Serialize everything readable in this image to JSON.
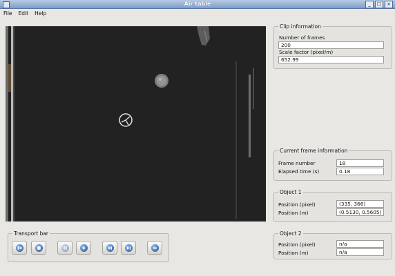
{
  "window": {
    "title": "Air table"
  },
  "menu": [
    "File",
    "Edit",
    "Help"
  ],
  "transport": {
    "title": "Transport bar",
    "buttons": [
      {
        "name": "skip-to-start-button",
        "icon": "skip-to-start-icon",
        "enabled": true
      },
      {
        "name": "step-back-button",
        "icon": "step-back-icon",
        "enabled": true
      },
      {
        "name": "pause-button",
        "icon": "pause-icon",
        "enabled": false
      },
      {
        "name": "play-button",
        "icon": "play-icon",
        "enabled": true
      },
      {
        "name": "step-forward-button",
        "icon": "step-forward-icon",
        "enabled": true
      },
      {
        "name": "skip-to-end-button",
        "icon": "skip-to-end-icon",
        "enabled": true
      },
      {
        "name": "stop-button",
        "icon": "stop-icon",
        "enabled": true
      }
    ]
  },
  "clip": {
    "title": "Clip information",
    "frames_label": "Number of frames",
    "frames_value": "200",
    "scale_label": "Scale factor (pixel/m)",
    "scale_value": "652.99"
  },
  "current": {
    "title": "Current frame information",
    "frame_label": "Frame number",
    "frame_value": "18",
    "elapsed_label": "Elapsed time (s)",
    "elapsed_value": "0.18"
  },
  "object1": {
    "title": "Object 1",
    "pos_pixel_label": "Position (pixel)",
    "pos_pixel_value": "(335, 366)",
    "pos_m_label": "Position (m)",
    "pos_m_value": "(0.5130, 0.5605)"
  },
  "object2": {
    "title": "Object 2",
    "pos_pixel_label": "Position (pixel)",
    "pos_pixel_value": "n/a",
    "pos_m_label": "Position (m)",
    "pos_m_value": "n/a"
  }
}
